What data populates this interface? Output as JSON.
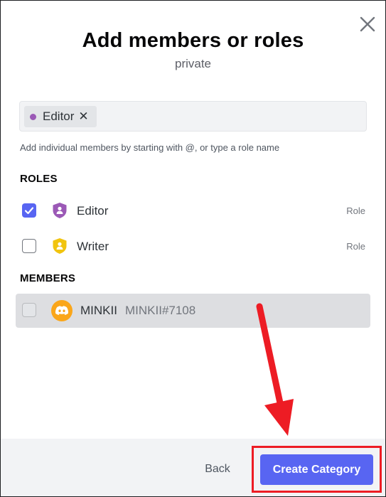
{
  "modal": {
    "title": "Add members or roles",
    "subtitle": "private"
  },
  "search": {
    "chip_label": "Editor",
    "chip_color": "#9b59b6",
    "chip_remove": "✕",
    "value": "",
    "placeholder": ""
  },
  "helper_text": "Add individual members by starting with @, or type a role name",
  "roles": {
    "header": "ROLES",
    "items": [
      {
        "name": "Editor",
        "tag": "Role",
        "checked": true,
        "color": "#9b59b6",
        "icon": "role-shield-icon"
      },
      {
        "name": "Writer",
        "tag": "Role",
        "checked": false,
        "color": "#f1c40f",
        "icon": "role-shield-icon"
      }
    ]
  },
  "members": {
    "header": "MEMBERS",
    "items": [
      {
        "name": "MINKII",
        "tag": "MINKII#7108",
        "checked": false,
        "avatar_color": "#faa61a",
        "icon": "discord-logo-icon"
      }
    ]
  },
  "footer": {
    "back_label": "Back",
    "create_label": "Create Category"
  },
  "colors": {
    "accent": "#5865f2",
    "annotation": "#ed1c24"
  }
}
